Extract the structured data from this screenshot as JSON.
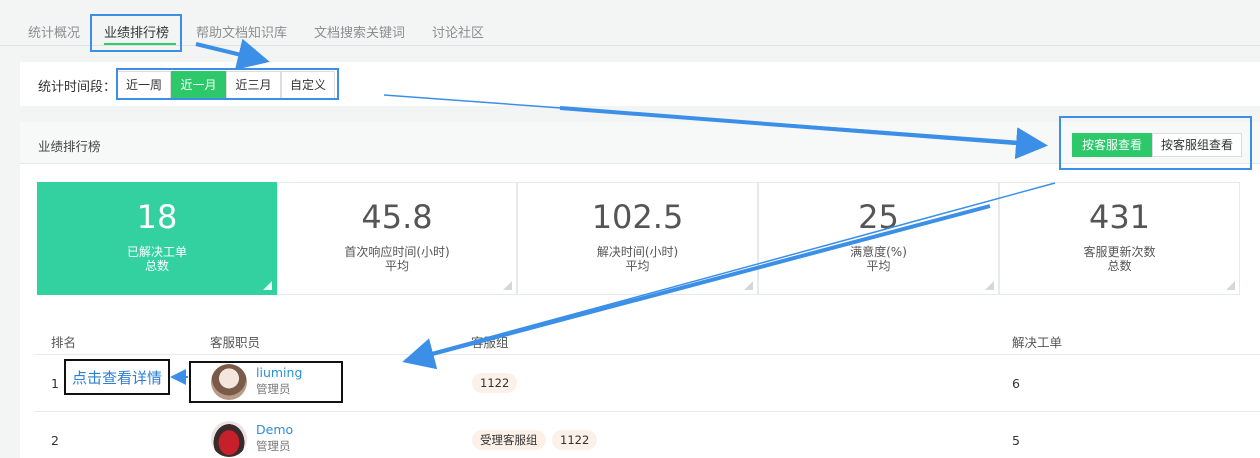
{
  "tabs": [
    {
      "label": "统计概况"
    },
    {
      "label": "业绩排行榜"
    },
    {
      "label": "帮助文档知识库"
    },
    {
      "label": "文档搜索关键词"
    },
    {
      "label": "讨论社区"
    }
  ],
  "filter": {
    "label": "统计时间段：",
    "options": [
      "近一周",
      "近一月",
      "近三月",
      "自定义"
    ],
    "selected": "近一月"
  },
  "panel": {
    "title": "业绩排行榜",
    "view_by_agent": "按客服查看",
    "view_by_group": "按客服组查看"
  },
  "stats": [
    {
      "value": "18",
      "label": "已解决工单",
      "sub": "总数"
    },
    {
      "value": "45.8",
      "label": "首次响应时间(小时)",
      "sub": "平均"
    },
    {
      "value": "102.5",
      "label": "解决时间(小时)",
      "sub": "平均"
    },
    {
      "value": "25",
      "label": "满意度(%)",
      "sub": "平均"
    },
    {
      "value": "431",
      "label": "客服更新次数",
      "sub": "总数"
    }
  ],
  "table": {
    "headers": [
      "排名",
      "客服职员",
      "客服组",
      "解决工单"
    ],
    "rows": [
      {
        "rank": "1",
        "name": "liuming",
        "role": "管理员",
        "groups": [
          "1122"
        ],
        "solved": "6"
      },
      {
        "rank": "2",
        "name": "Demo",
        "role": "管理员",
        "groups": [
          "受理客服组",
          "1122"
        ],
        "solved": "5"
      }
    ]
  },
  "annotation": {
    "detail_hint": "点击查看详情"
  },
  "colors": {
    "accent_green": "#2dc86a",
    "stat_teal": "#33d1a0",
    "annotation_blue": "#3b8fe6",
    "link_blue": "#2b8fd6"
  }
}
